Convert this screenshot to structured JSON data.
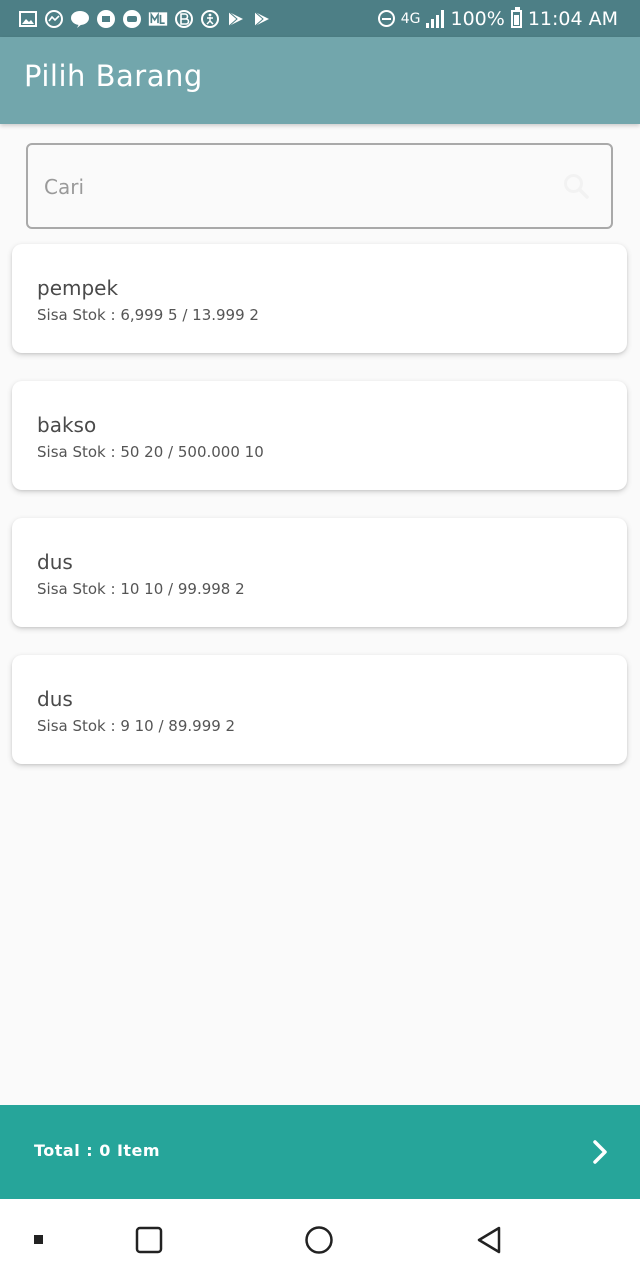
{
  "status_bar": {
    "left_icons": [
      "image-icon",
      "messenger-icon",
      "line-icon",
      "chat-icon",
      "game-icon",
      "ml-icon",
      "b-icon",
      "accessibility-icon",
      "play-store-icon",
      "play-store-icon"
    ],
    "network": "4G",
    "battery": "100%",
    "time": "11:04 AM",
    "color": "#4d7f86"
  },
  "app_bar": {
    "title": "Pilih Barang",
    "color": "#72a6ac"
  },
  "search": {
    "placeholder": "Cari",
    "value": ""
  },
  "items": [
    {
      "name": "pempek",
      "stock": "Sisa Stok : 6,999 5 / 13.999 2"
    },
    {
      "name": "bakso",
      "stock": "Sisa Stok : 50 20 / 500.000 10"
    },
    {
      "name": "dus",
      "stock": "Sisa Stok : 10 10 / 99.998 2"
    },
    {
      "name": "dus",
      "stock": "Sisa Stok : 9 10 / 89.999 2"
    }
  ],
  "footer": {
    "total": "Total : 0 Item",
    "color": "#26a59a",
    "next_icon": "chevron-right-icon"
  },
  "nav_bar": {
    "items": [
      "recent-dot-icon",
      "overview-square-icon",
      "home-circle-icon",
      "back-triangle-icon"
    ]
  }
}
